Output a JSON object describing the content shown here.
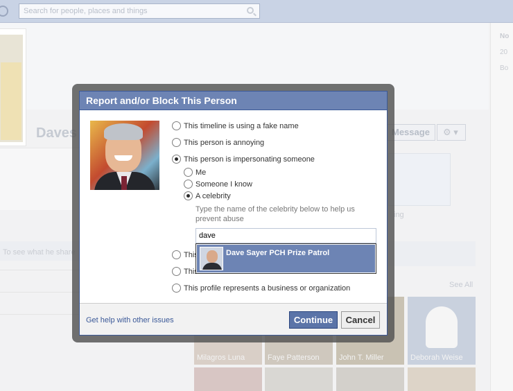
{
  "topbar": {
    "search_placeholder": "Search for people, places and things"
  },
  "background": {
    "profile_name": "Daves",
    "message_button": "Message",
    "see_what_text": "To see what he share",
    "ing_text": "ing",
    "see_all": "See All",
    "right_column": [
      "No",
      "20",
      "Bo"
    ],
    "friends": [
      "Milagros Luna",
      "Faye Patterson",
      "John T. Miller",
      "Deborah Weise"
    ]
  },
  "dialog": {
    "title": "Report and/or Block This Person",
    "options": {
      "fake_name": "This timeline is using a fake name",
      "annoying": "This person is annoying",
      "impersonating": "This person is impersonating someone",
      "me": "Me",
      "someone_i_know": "Someone I know",
      "celebrity": "A celebrity",
      "hidden_1": "This",
      "hidden_2": "This",
      "business": "This profile represents a business or organization"
    },
    "hint": "Type the name of the celebrity below to help us prevent abuse",
    "celebrity_input_value": "dave",
    "suggestion": "Dave Sayer PCH Prize Patrol",
    "help_link": "Get help with other issues",
    "continue_label": "Continue",
    "cancel_label": "Cancel"
  },
  "colors": {
    "title_bar": "#6d84b4",
    "border": "#3b5998",
    "link": "#3b5998",
    "continue_button": "#5b74a8"
  }
}
